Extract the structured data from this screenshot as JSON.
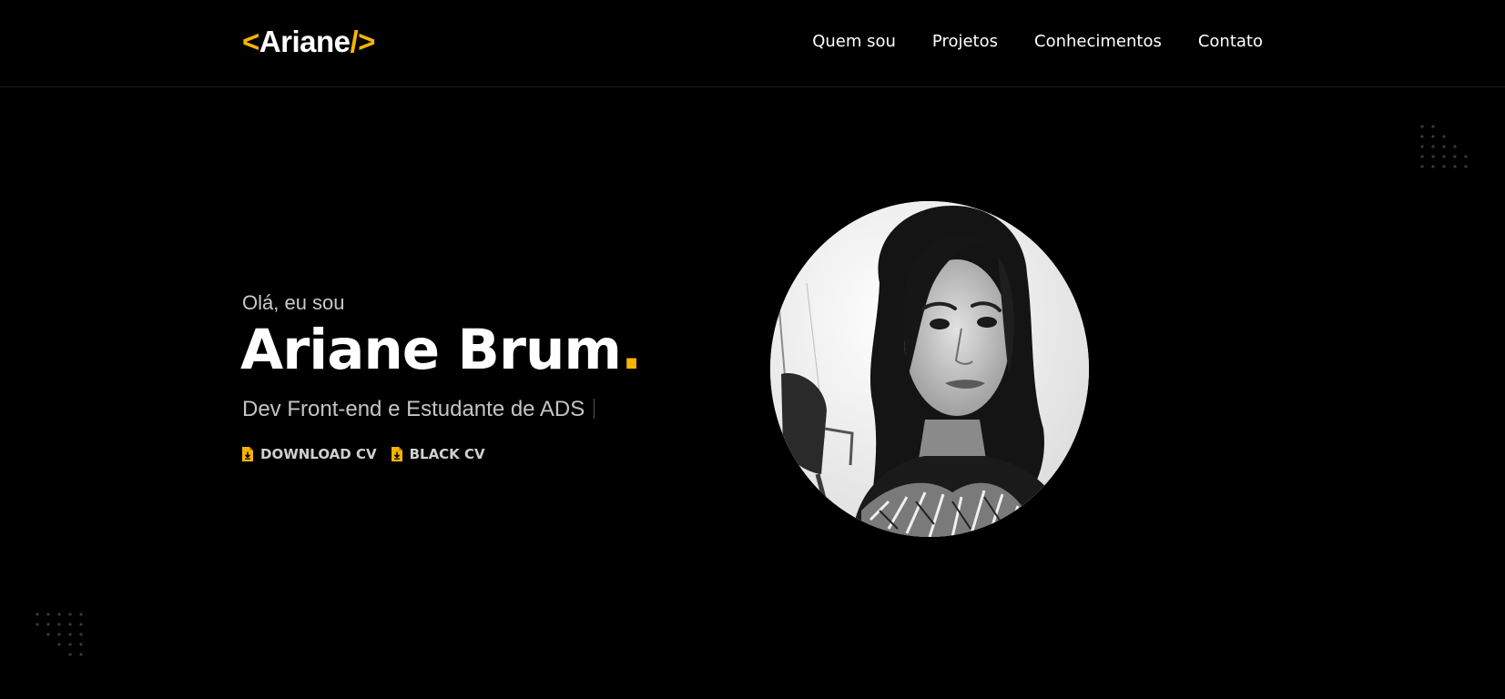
{
  "header": {
    "logo": {
      "open": "<",
      "name": "Ariane",
      "slash": "/",
      "close": ">"
    },
    "nav": [
      "Quem sou",
      "Projetos",
      "Conhecimentos",
      "Contato"
    ]
  },
  "hero": {
    "greeting": "Olá, eu sou",
    "name": "Ariane Brum",
    "name_dot": ".",
    "subtitle": "Dev Front-end e Estudante de ADS",
    "cv_links": [
      {
        "label": "DOWNLOAD CV",
        "icon": "file-download-icon"
      },
      {
        "label": "BLACK CV",
        "icon": "file-download-icon"
      }
    ],
    "photo": "profile-photo"
  },
  "colors": {
    "background": "#000000",
    "accent": "#f5b400",
    "text": "#ffffff",
    "muted": "#c4c4c4"
  }
}
